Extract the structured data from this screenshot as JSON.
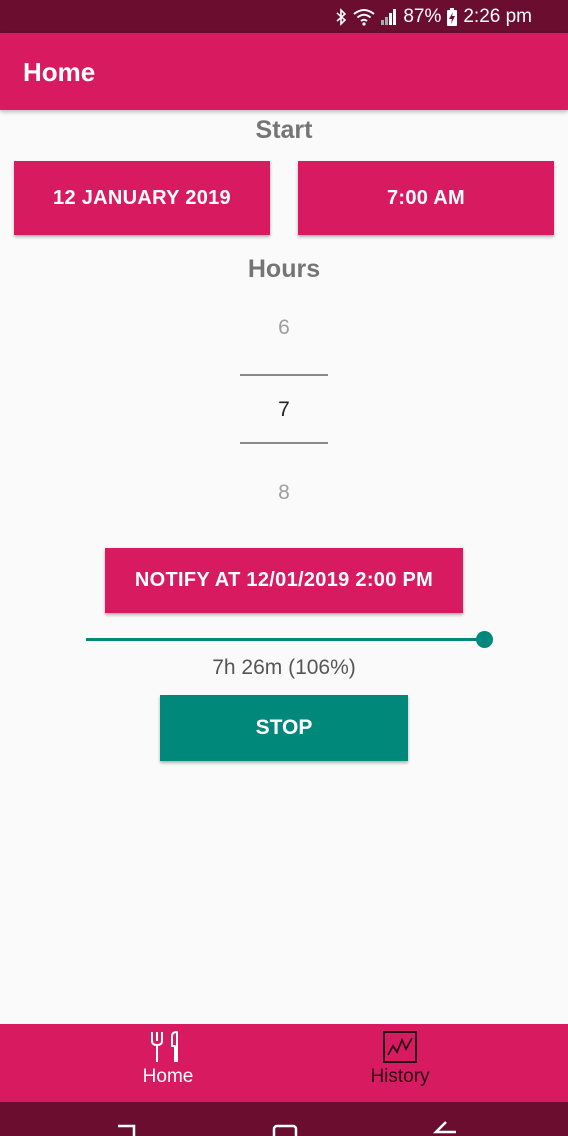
{
  "status_bar": {
    "battery": "87%",
    "time": "2:26 pm",
    "icons": [
      "bluetooth-icon",
      "wifi-icon",
      "signal-icon",
      "battery-charging-icon"
    ]
  },
  "app_bar": {
    "title": "Home"
  },
  "start": {
    "label": "Start",
    "date_button": "12 JANUARY 2019",
    "time_button": "7:00 AM"
  },
  "hours": {
    "label": "Hours",
    "prev": "6",
    "selected": "7",
    "next": "8"
  },
  "notify_button": "NOTIFY AT 12/01/2019 2:00 PM",
  "progress": {
    "text": "7h 26m (106%)",
    "value_fraction": 1.0
  },
  "stop_button": "STOP",
  "bottom_nav": {
    "items": [
      {
        "label": "Home",
        "icon": "fork-knife-icon",
        "active": true
      },
      {
        "label": "History",
        "icon": "chart-icon",
        "active": false
      }
    ]
  },
  "colors": {
    "primary": "#d81b60",
    "primary_dark": "#6a0d2f",
    "accent": "#00897b",
    "background": "#fafafa"
  }
}
